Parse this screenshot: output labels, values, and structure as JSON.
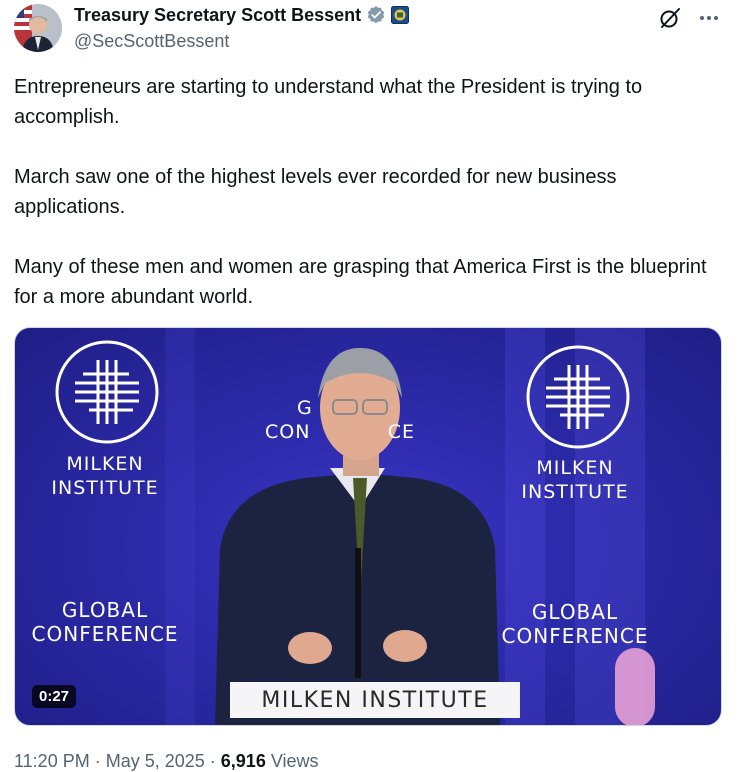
{
  "author": {
    "display_name": "Treasury Secretary Scott Bessent",
    "handle": "@SecScottBessent",
    "verified_color": "#829aab"
  },
  "tweet": {
    "paragraphs": [
      "Entrepreneurs are starting to understand what the President is trying to accomplish.",
      "March saw one of the highest levels ever recorded for new business applications.",
      "Many of these men and women are grasping that America First is the blueprint for a more abundant world."
    ]
  },
  "media": {
    "duration": "0:27",
    "left_logo": {
      "line1": "MILKEN",
      "line2": "INSTITUTE"
    },
    "right_logo": {
      "line1": "MILKEN",
      "line2": "INSTITUTE"
    },
    "left_conference": {
      "line1": "GLOBAL",
      "line2": "CONFERENCE"
    },
    "right_conference": {
      "line1": "GLOBAL",
      "line2": "CONFERENCE"
    },
    "center_partial": {
      "line1": "G",
      "line2_a": "CON",
      "line2_b": "CE"
    },
    "podium_sign": "MILKEN INSTITUTE",
    "background_color": "#2b2aa8"
  },
  "meta": {
    "time": "11:20 PM",
    "separator": " · ",
    "date": "May 5, 2025",
    "views_count": "6,916",
    "views_label": " Views"
  }
}
